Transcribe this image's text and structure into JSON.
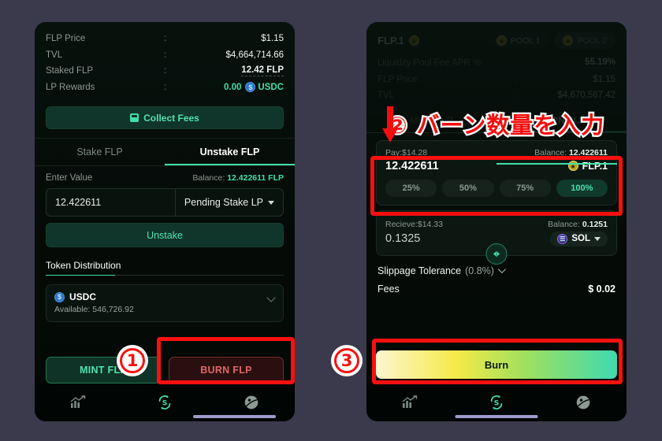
{
  "left_panel": {
    "stats": [
      {
        "label": "FLP Price",
        "value": "$1.15",
        "style": "plain"
      },
      {
        "label": "TVL",
        "value": "$4,664,714.66",
        "style": "plain"
      },
      {
        "label": "Staked FLP",
        "value": "12.42 FLP",
        "style": "dashed"
      },
      {
        "label": "LP Rewards",
        "value": "0.00",
        "style": "teal",
        "suffix": "USDC"
      }
    ],
    "collect_fees_label": "Collect Fees",
    "tabs": [
      {
        "label": "Stake FLP",
        "active": false
      },
      {
        "label": "Unstake FLP",
        "active": true
      }
    ],
    "enter_value_label": "Enter Value",
    "balance_label": "Balance:",
    "balance_value": "12.422611 FLP",
    "input_value": "12.422611",
    "input_select": "Pending Stake LP",
    "unstake_button": "Unstake",
    "token_distribution_title": "Token Distribution",
    "token": {
      "symbol": "USDC",
      "icon_glyph": "$",
      "available_label": "Available:",
      "available_value": "546,726.92"
    },
    "mint_button": "MINT FLP",
    "burn_button": "BURN FLP"
  },
  "right_panel": {
    "title": "FLP.1",
    "pool_tabs": [
      {
        "label": "POOL 1",
        "active": true
      },
      {
        "label": "POOL 2",
        "active": false
      }
    ],
    "stats": [
      {
        "label": "Liquidity Pool Fee APR %",
        "value": "55.19%",
        "style": "dashed"
      },
      {
        "label": "FLP Price",
        "value": "$1.15",
        "style": "plain"
      },
      {
        "label": "TVL",
        "value": "$4,670,567.42",
        "style": "plain"
      }
    ],
    "mb_tabs": [
      {
        "label": "MINT FLP",
        "active": false
      },
      {
        "label": "BURN FLP",
        "active": true
      }
    ],
    "pay": {
      "label": "Pay:",
      "usd": "$14.28",
      "balance_label": "Balance:",
      "balance_value": "12.422611",
      "amount": "12.422611",
      "token": "FLP.1",
      "percents": [
        {
          "label": "25%",
          "active": false
        },
        {
          "label": "50%",
          "active": false
        },
        {
          "label": "75%",
          "active": false
        },
        {
          "label": "100%",
          "active": true
        }
      ]
    },
    "receive": {
      "label": "Recieve:",
      "usd": "$14.33",
      "balance_label": "Balance:",
      "balance_value": "0.1251",
      "amount": "0.1325",
      "token": "SOL"
    },
    "slippage_label": "Slippage Tolerance",
    "slippage_value": "(0.8%)",
    "fees_label": "Fees",
    "fees_value": "$ 0.02",
    "burn_cta": "Burn"
  },
  "bottom_nav": [
    {
      "name": "chart-icon",
      "active": false
    },
    {
      "name": "swap-icon",
      "active": true
    },
    {
      "name": "globe-icon",
      "active": false
    }
  ],
  "annotations": {
    "step1": "①",
    "step2_text": "② バーン数量を入力",
    "step3": "③",
    "marker1_num": "1",
    "marker3_num": "3"
  },
  "colors": {
    "accent_teal": "#3fe0a8",
    "annotation_red": "#f81010",
    "burn_red": "#e06666",
    "gold": "#f2e06a"
  }
}
